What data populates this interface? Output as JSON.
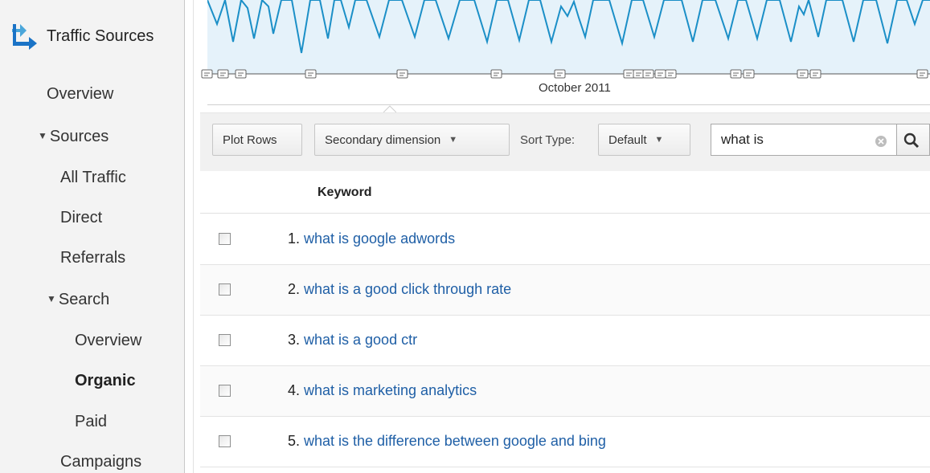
{
  "sidebar": {
    "header": {
      "icon": "traffic-sources-arrow-icon",
      "title": "Traffic Sources"
    },
    "items": [
      {
        "label": "Overview"
      },
      {
        "label": "Sources",
        "expanded": true
      },
      {
        "label": "All Traffic"
      },
      {
        "label": "Direct"
      },
      {
        "label": "Referrals"
      },
      {
        "label": "Search",
        "expanded": true
      },
      {
        "label": "Overview"
      },
      {
        "label": "Organic",
        "selected": true
      },
      {
        "label": "Paid"
      },
      {
        "label": "Campaigns"
      }
    ]
  },
  "chart": {
    "month_label": "October 2011",
    "line_color": "#1b8fc7",
    "fill_color": "#e5f2fa",
    "annotation_icon": "annotation-note-icon"
  },
  "toolbar": {
    "plot_rows": "Plot Rows",
    "secondary_dimension": "Secondary dimension",
    "sort_type_label": "Sort Type:",
    "sort_type_value": "Default",
    "search_value": "what is"
  },
  "table": {
    "column_header": "Keyword",
    "rows": [
      {
        "num": "1.",
        "keyword": "what is google adwords"
      },
      {
        "num": "2.",
        "keyword": "what is a good click through rate"
      },
      {
        "num": "3.",
        "keyword": "what is a good ctr"
      },
      {
        "num": "4.",
        "keyword": "what is marketing analytics"
      },
      {
        "num": "5.",
        "keyword": "what is the difference between google and bing"
      }
    ]
  },
  "colors": {
    "link": "#1f5fa6",
    "sidebar_bg": "#f3f3f3",
    "toolbar_bg": "#f1f1f1"
  }
}
